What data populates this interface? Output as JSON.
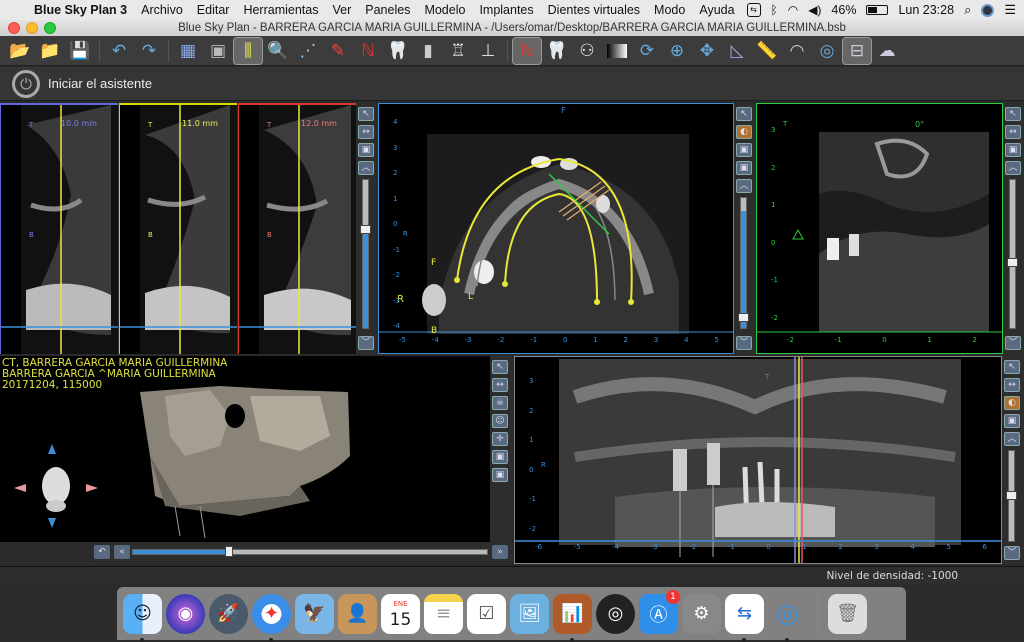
{
  "menubar": {
    "app_name": "Blue Sky Plan 3",
    "items": [
      "Archivo",
      "Editar",
      "Herramientas",
      "Ver",
      "Paneles",
      "Modelo",
      "Implantes",
      "Dientes virtuales",
      "Modo",
      "Ayuda"
    ],
    "battery": "46%",
    "clock": "Lun 23:28"
  },
  "window": {
    "title": "Blue Sky Plan - BARRERA GARCIA  MARIA GUILLERMINA - /Users/omar/Desktop/BARRERA GARCIA  MARIA GUILLERMINA.bsb"
  },
  "wizard": {
    "label": "Iniciar el asistente"
  },
  "cross_sections": [
    {
      "depth": "10.0 mm",
      "color": "#7d7df0",
      "border": "#6464dd"
    },
    {
      "depth": "11.0 mm",
      "color": "#ecec5a",
      "border": "#d8d800"
    },
    {
      "depth": "12.0 mm",
      "color": "#e77",
      "border": "#dd3333"
    }
  ],
  "axial_view": {
    "orient_top": "F",
    "orient_left": "F",
    "orient_side": "L",
    "orient_right": "R",
    "orient_bottom": "B",
    "side_r": "R",
    "ruler_labels": [
      "-5",
      "-4",
      "-3",
      "-2",
      "-1",
      "0",
      "1",
      "2",
      "3",
      "4",
      "5"
    ],
    "y_labels": [
      "4",
      "3",
      "2",
      "1",
      "0",
      "-1",
      "-2",
      "-3",
      "-4"
    ]
  },
  "sagittal_view": {
    "orient_top": "T",
    "angle": "0°",
    "ruler_labels": [
      "-2",
      "-1",
      "0",
      "1",
      "2"
    ],
    "y_labels": [
      "3",
      "2",
      "1",
      "0",
      "-1",
      "-2"
    ]
  },
  "volume_view": {
    "patient_lines": [
      "CT, BARRERA GARCIA  MARIA GUILLERMINA",
      "BARRERA GARCIA ^MARIA GUILLERMINA",
      "20171204, 115000"
    ],
    "dropdown_value": ""
  },
  "panoramic_view": {
    "orient_top": "T",
    "side_r": "R",
    "ruler_labels": [
      "-6",
      "-5",
      "-4",
      "-3",
      "-2",
      "-1",
      "0",
      "1",
      "2",
      "3",
      "4",
      "5",
      "6"
    ],
    "y_labels": [
      "3",
      "2",
      "1",
      "0",
      "-1",
      "-2"
    ]
  },
  "status": {
    "density": "Nivel de densidad: -1000"
  },
  "dock": {
    "calendar_month": "ENE",
    "calendar_day": "15",
    "appstore_badge": "1"
  },
  "colors": {
    "yellow": "#e8e838",
    "blue_line": "#3b8fd9",
    "green_line": "#2ecc40"
  }
}
